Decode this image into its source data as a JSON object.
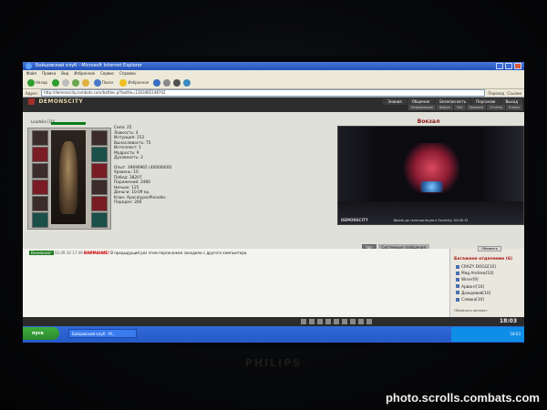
{
  "browser": {
    "window_title": "Бойцовский клуб - Microsoft Internet Explorer",
    "menu": [
      "Файл",
      "Правка",
      "Вид",
      "Избранное",
      "Сервис",
      "Справка"
    ],
    "toolbar": {
      "back_label": "Назад",
      "search_label": "Поиск",
      "favorites_label": "Избранное"
    },
    "address_label": "Адрес:",
    "address_url": "http://demonscity.combats.com/battles.pl?battle=1303485148702",
    "go_label": "Переход",
    "links_label": "Ссылки"
  },
  "game": {
    "logo": "DEMONSCITY",
    "top_nav": [
      "Знания",
      "Общение",
      "Безопасность",
      "Персонаж",
      "Выход"
    ],
    "sub_nav": [
      "Информация",
      "Форум",
      "Чат",
      "Правила",
      "Отчёты",
      "Кланы"
    ],
    "character": {
      "name": "Loudolio",
      "level": "[10]",
      "stats": [
        "Сила: 25",
        "Ловкость: 4",
        "Интуиция: 152",
        "Выносливость: 75",
        "Интеллект: 1",
        "Мудрость: 9",
        "Духовность: 2"
      ],
      "stats2": [
        "Опыт: 39696965 (40000000)",
        "Уровень: 10",
        "Побед: 28207",
        "Поражений: 2480",
        "Ничьих: 125",
        "Деньги: 10.09 кр.",
        "Клан: ApocalypsePleiades",
        "Передач: 200"
      ]
    },
    "location": {
      "title": "Вокзал",
      "brand": "DEMONSCITY",
      "caption": "Время до телепортации в Sandcity: 04:08:15"
    },
    "chat": {
      "tabs": [
        "Чат",
        "Системные сообщения"
      ],
      "tag": "Внимание!",
      "time": "02.09.10 17:49",
      "warn": "ВНИМАНИЕ!",
      "text": "В предыдущий раз этим персонажем заходили с другого компьютера."
    },
    "online": {
      "refresh": "Обновить",
      "header": "Багажное отделение (6)",
      "users": [
        "CRAZY DOGG[10]",
        "Mag Andrew[10]",
        "Winer[9]",
        "Арвинт[10]",
        "Дождевой[10]",
        "Слевка[10]"
      ],
      "auto_refresh": "Обновлять автомат."
    },
    "clock": "18:03"
  },
  "taskbar": {
    "start": "пуск",
    "task": "Бойцовский клуб - M...",
    "tray_time": "18:03"
  },
  "monitor": {
    "brand": "PHILIPS"
  },
  "watermark": "photo.scrolls.combats.com",
  "colors": {
    "accent_red": "#8a1515",
    "xp_blue": "#245bc9",
    "hp_green": "#0b7b1d"
  }
}
